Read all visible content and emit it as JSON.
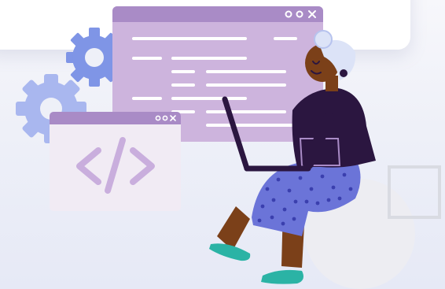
{
  "illustration": {
    "subject": "developer-with-laptop",
    "icons": [
      "gear-icon",
      "code-brackets-icon",
      "window-controls-icon"
    ]
  },
  "colors": {
    "background_top": "#f7f7fb",
    "background_bottom": "#e6e9f6",
    "card": "#ffffff",
    "code_window_bg": "#cdb4dd",
    "code_window_bar": "#a98bc6",
    "small_window_bg": "#f1ebf4",
    "gear_primary": "#7f95e6",
    "gear_secondary": "#a9b7ef",
    "shirt": "#2b1640",
    "pants": "#6b74d8",
    "pants_dots": "#3a3fae",
    "skin": "#7b4019",
    "hair_wrap": "#dce3f7",
    "shoes": "#2bb3a5"
  }
}
